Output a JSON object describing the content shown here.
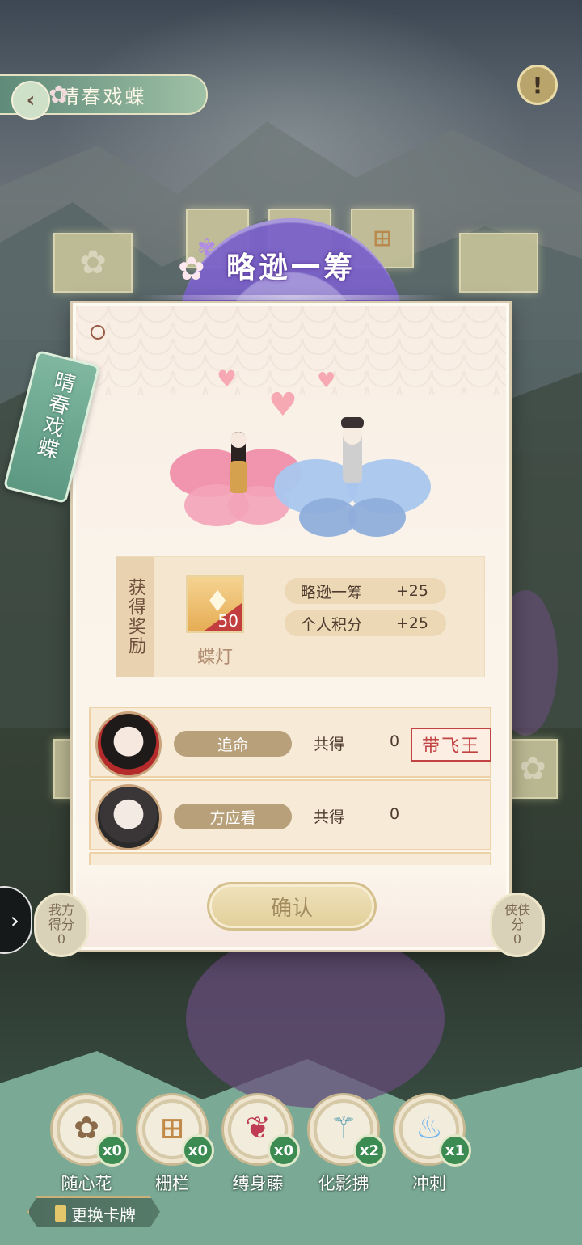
{
  "header": {
    "title": "晴春戏蝶",
    "back_icon": "‹",
    "info_icon": "!"
  },
  "banner": {
    "title": "略逊一筹"
  },
  "tag": {
    "text": "晴春戏蝶"
  },
  "reward": {
    "label": "获得奖励",
    "item": {
      "name": "蝶灯",
      "quantity": "50"
    },
    "scores": [
      {
        "label": "略逊一筹",
        "value": "+25"
      },
      {
        "label": "个人积分",
        "value": "+25"
      }
    ]
  },
  "players": [
    {
      "name": "追命",
      "total_label": "共得",
      "total": "0",
      "stamp": "带飞王"
    },
    {
      "name": "方应看",
      "total_label": "共得",
      "total": "0"
    }
  ],
  "confirm_label": "确认",
  "side": {
    "left_score": {
      "label": "我方得分",
      "value": "0"
    },
    "right_score": {
      "label": "侠伕分",
      "value": "0"
    }
  },
  "tools": [
    {
      "name": "随心花",
      "count": "x0",
      "icon": "flower-basket-icon"
    },
    {
      "name": "栅栏",
      "count": "x0",
      "icon": "fence-icon"
    },
    {
      "name": "缚身藤",
      "count": "x0",
      "icon": "vine-plant-icon"
    },
    {
      "name": "化影拂",
      "count": "x2",
      "icon": "whisk-icon"
    },
    {
      "name": "冲刺",
      "count": "x1",
      "icon": "blue-flame-icon"
    }
  ],
  "change_card_label": "更换卡牌",
  "colors": {
    "accent_green": "#3c8b52",
    "stamp_red": "#c24343",
    "banner_purple": "#7a62c8"
  }
}
